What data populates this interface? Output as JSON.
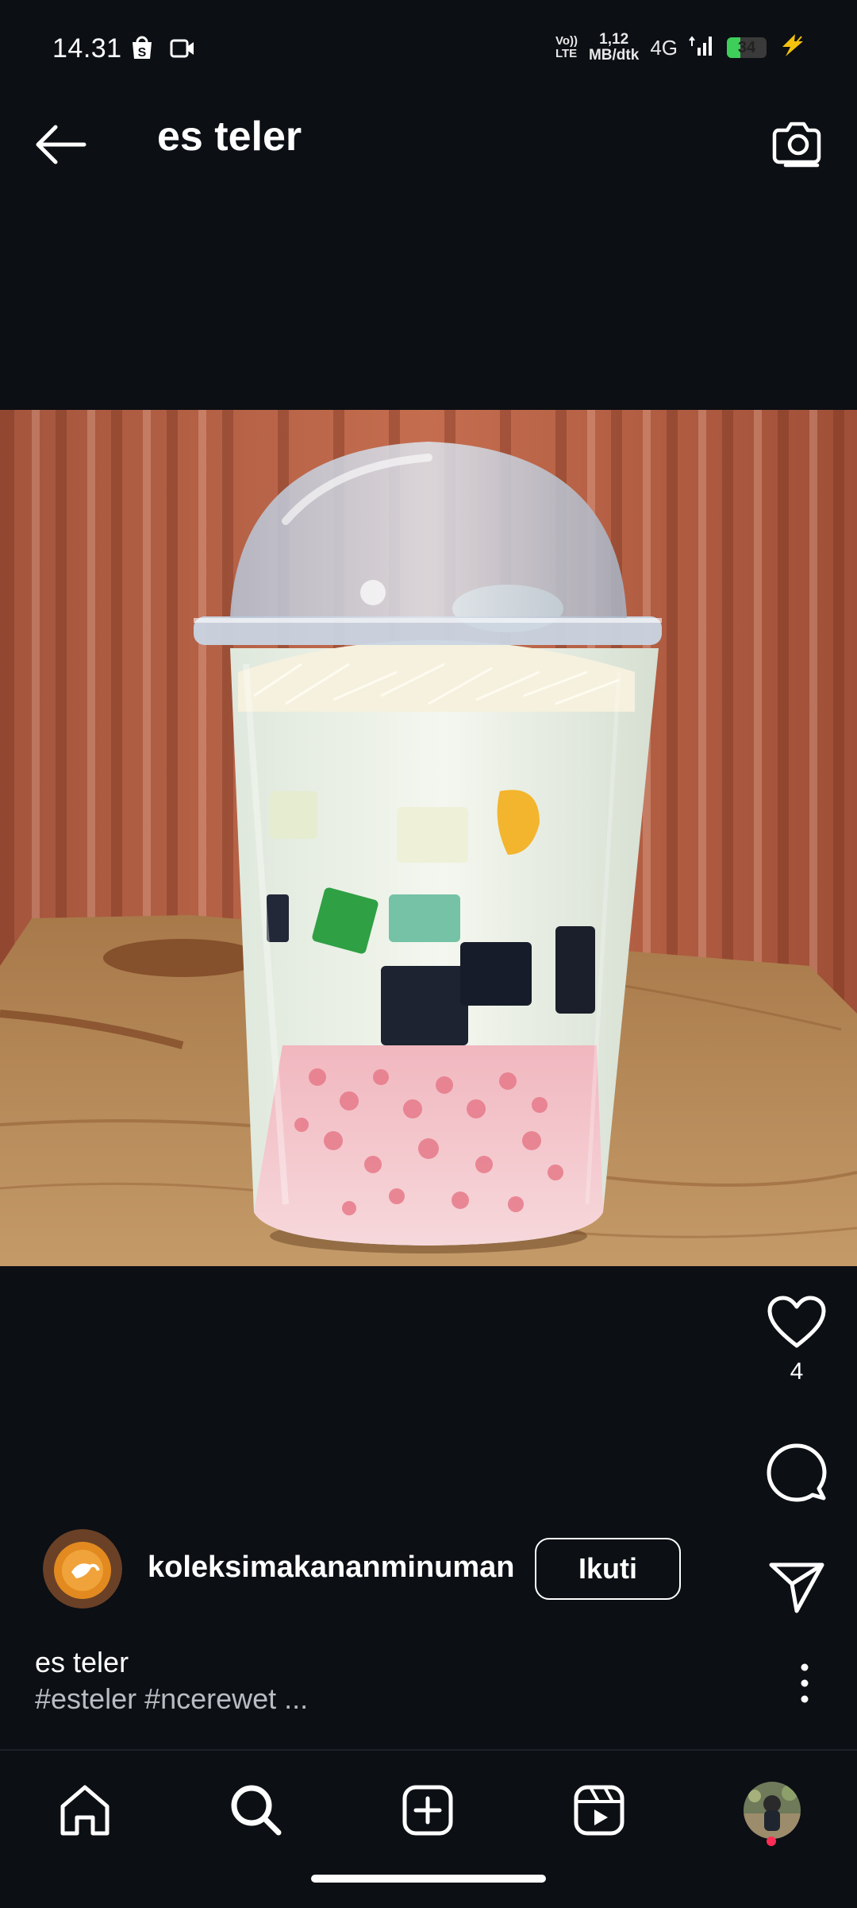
{
  "status": {
    "time": "14.31",
    "volte_top": "Vo))",
    "volte_bottom": "LTE",
    "speed_value": "1,12",
    "speed_unit": "MB/dtk",
    "network": "4G",
    "battery_level": "34",
    "battery_fraction": 0.34
  },
  "header": {
    "title": "es teler"
  },
  "post": {
    "like_count": "4",
    "author": "koleksimakananminuman",
    "follow_label": "Ikuti",
    "caption": "es teler",
    "hashtags": "#esteler #ncerewet ..."
  },
  "colors": {
    "background": "#0c0f14",
    "notification_dot": "#ff2d55",
    "battery_green": "#3ecf5a",
    "charging_bolt": "#f4c20d"
  },
  "icons": {
    "back": "arrow-left-icon",
    "camera": "camera-icon",
    "like": "heart-icon",
    "comment": "comment-icon",
    "share": "send-icon",
    "more": "more-vertical-icon",
    "home": "home-icon",
    "search": "search-icon",
    "create": "plus-square-icon",
    "reels": "reels-icon"
  }
}
